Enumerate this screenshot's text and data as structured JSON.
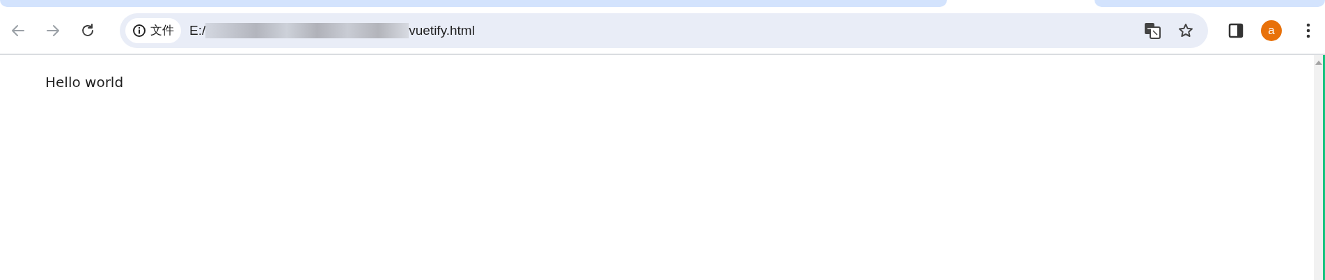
{
  "address_bar": {
    "security_chip": "文件",
    "url_start": "E:/",
    "url_end": "vuetify.html"
  },
  "profile": {
    "initial": "a"
  },
  "page": {
    "text": "Hello world"
  }
}
